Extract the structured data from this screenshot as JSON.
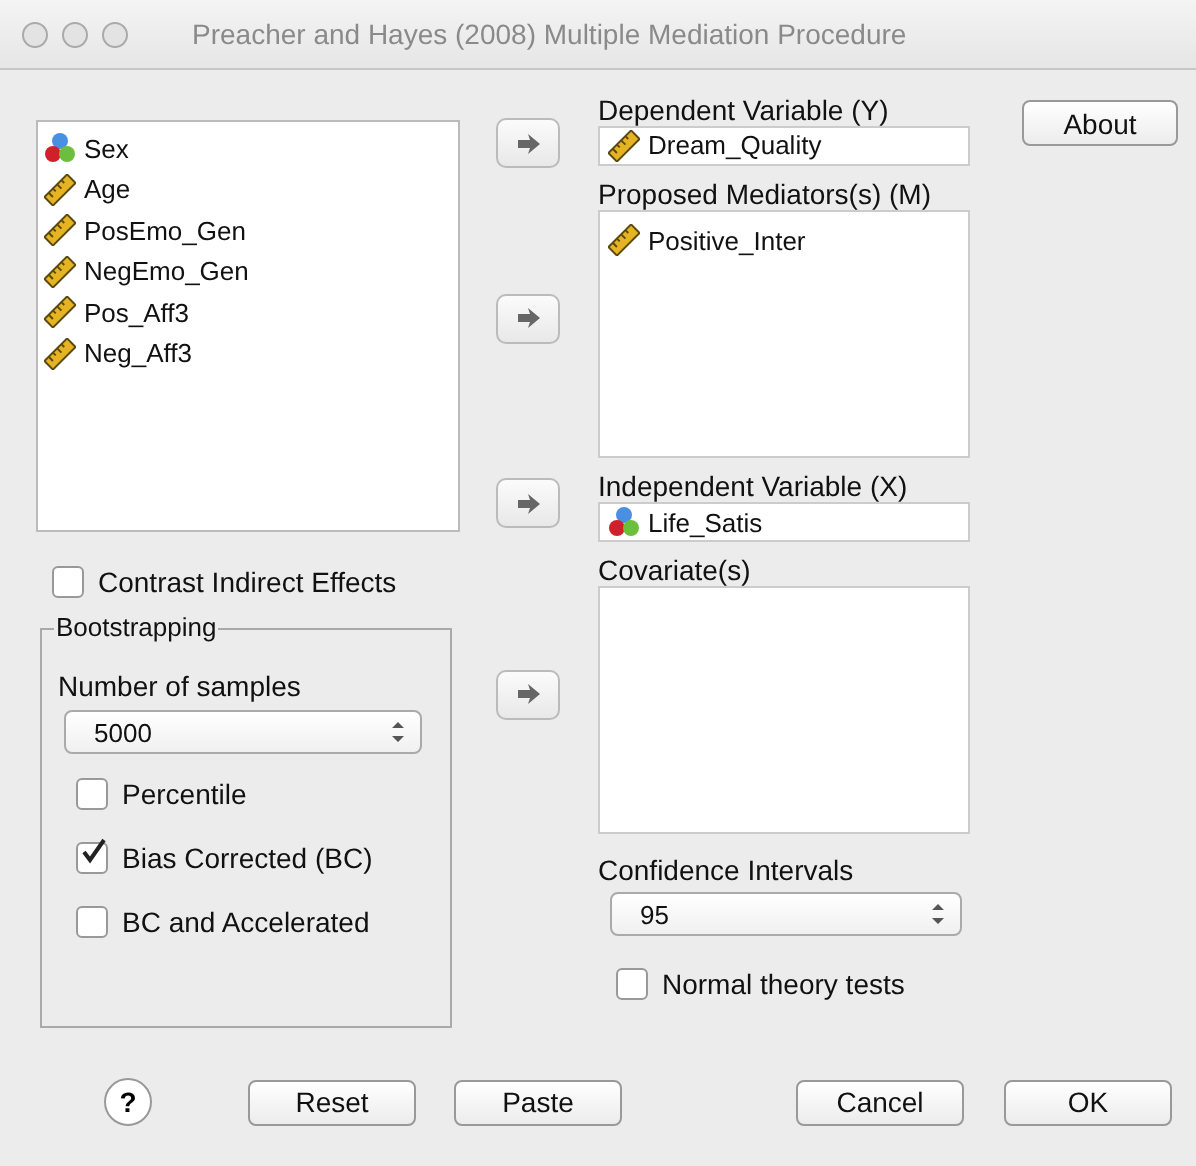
{
  "window": {
    "title": "Preacher and Hayes (2008) Multiple Mediation Procedure"
  },
  "variables": [
    {
      "name": "Sex",
      "kind": "nominal"
    },
    {
      "name": "Age",
      "kind": "scale"
    },
    {
      "name": "PosEmo_Gen",
      "kind": "scale"
    },
    {
      "name": "NegEmo_Gen",
      "kind": "scale"
    },
    {
      "name": "Pos_Aff3",
      "kind": "scale"
    },
    {
      "name": "Neg_Aff3",
      "kind": "scale"
    }
  ],
  "targets": [
    {
      "label": "Dependent Variable (Y)",
      "kind": "single",
      "items": [
        {
          "name": "Dream_Quality",
          "kind": "scale"
        }
      ]
    },
    {
      "label": "Proposed Mediators(s) (M)",
      "kind": "list",
      "items": [
        {
          "name": "Positive_Inter",
          "kind": "scale"
        }
      ]
    },
    {
      "label": "Independent Variable (X)",
      "kind": "single",
      "items": [
        {
          "name": "Life_Satis",
          "kind": "nominal"
        }
      ]
    },
    {
      "label": "Covariate(s)",
      "kind": "list"
    }
  ],
  "contrast": {
    "label": "Contrast Indirect Effects",
    "checked": false
  },
  "bootstrapping": {
    "title": "Bootstrapping",
    "samples_label": "Number of samples",
    "samples": "5000",
    "options": [
      {
        "label": "Percentile",
        "checked": false
      },
      {
        "label": "Bias Corrected (BC)",
        "checked": true
      },
      {
        "label": "BC and Accelerated",
        "checked": false
      }
    ]
  },
  "confidence": {
    "label": "Confidence Intervals",
    "value": "95"
  },
  "normal_theory": {
    "label": "Normal theory tests",
    "checked": false
  },
  "about_button": "About",
  "help_button": "?",
  "buttons": [
    "Reset",
    "Paste",
    "Cancel",
    "OK"
  ]
}
